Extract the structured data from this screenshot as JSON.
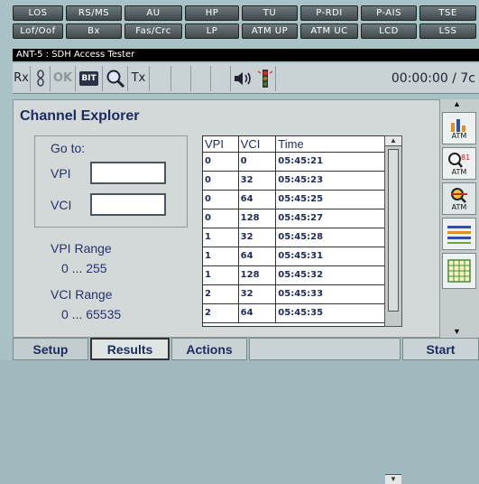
{
  "alarms": {
    "row1": [
      "LOS",
      "RS/MS",
      "AU",
      "HP",
      "TU",
      "P-RDI",
      "P-AIS",
      "TSE"
    ],
    "row2": [
      "Lof/Oof",
      "Bx",
      "Fas/Crc",
      "LP",
      "ATM UP",
      "ATM UC",
      "LCD",
      "LSS"
    ]
  },
  "window_title": "ANT-5 : SDH Access Tester",
  "statusbar": {
    "rx": "Rx",
    "ok": "OK",
    "bit": "BIT",
    "tx": "Tx",
    "time": "00:00:00 / 7c"
  },
  "panel": {
    "title": "Channel Explorer",
    "goto_label": "Go to:",
    "vpi_label": "VPI",
    "vci_label": "VCI",
    "vpi_value": "",
    "vci_value": "",
    "vpi_range_label": "VPI Range",
    "vpi_range_value": "0 ... 255",
    "vci_range_label": "VCI Range",
    "vci_range_value": "0 ... 65535"
  },
  "table": {
    "headers": [
      "VPI",
      "VCI",
      "Time"
    ],
    "rows": [
      [
        "0",
        "0",
        "05:45:21"
      ],
      [
        "0",
        "32",
        "05:45:23"
      ],
      [
        "0",
        "64",
        "05:45:25"
      ],
      [
        "0",
        "128",
        "05:45:27"
      ],
      [
        "1",
        "32",
        "05:45:28"
      ],
      [
        "1",
        "64",
        "05:45:31"
      ],
      [
        "1",
        "128",
        "05:45:32"
      ],
      [
        "2",
        "32",
        "05:45:33"
      ],
      [
        "2",
        "64",
        "05:45:35"
      ]
    ]
  },
  "side": {
    "atm_caption": "ATM",
    "atm_badge": "81",
    "icons": [
      "bar-chart-icon",
      "magnifier-atm-icon",
      "atm-channel-icon",
      "lines-icon",
      "grid-icon"
    ]
  },
  "tabs": {
    "setup": "Setup",
    "results": "Results",
    "actions": "Actions",
    "start": "Start"
  },
  "colors": {
    "background": "#a8c2c6",
    "panel": "#d3d8d9",
    "text_blue": "#1e2a5e",
    "alarm": "#505a5d"
  }
}
